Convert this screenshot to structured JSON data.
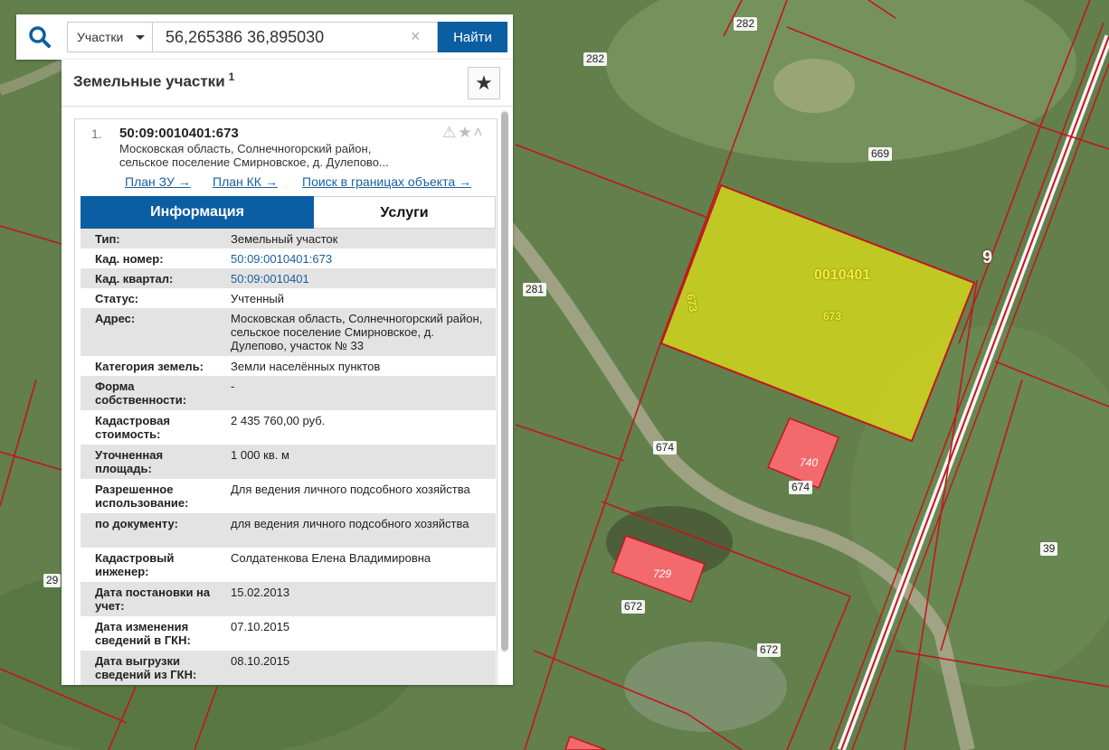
{
  "search": {
    "type_label": "Участки",
    "query": "56,265386 36,895030",
    "button_label": "Найти",
    "clear_glyph": "×"
  },
  "panel": {
    "title": "Земельные участки",
    "count": "1",
    "bookmark_glyph": "★"
  },
  "result": {
    "index": "1.",
    "cadastral_number": "50:09:0010401:673",
    "address_lines": [
      "Московская область, Солнечногорский район,",
      "сельское поселение Смирновское, д. Дулепово..."
    ],
    "icons_glyph": "⚠★˄",
    "links": [
      "План ЗУ →",
      "План КК →",
      "Поиск в границах объекта →"
    ]
  },
  "tabs": {
    "info": "Информация",
    "services": "Услуги"
  },
  "info_rows": [
    {
      "key": "Тип:",
      "value": "Земельный участок"
    },
    {
      "key": "Кад. номер:",
      "value": "50:09:0010401:673"
    },
    {
      "key": "Кад. квартал:",
      "value": "50:09:0010401"
    },
    {
      "key": "Статус:",
      "value": "Учтенный"
    },
    {
      "key": "Адрес:",
      "value": "Московская область, Солнечногорский район, сельское поселение Смирновское, д. Дулепово, участок № 33"
    },
    {
      "key": "Категория земель:",
      "value": "Земли населённых пунктов"
    },
    {
      "key": "Форма собственности:",
      "value": "-"
    },
    {
      "key": "Кадастровая стоимость:",
      "value": "2 435 760,00 руб."
    },
    {
      "key": "Уточненная площадь:",
      "value": "1 000 кв. м"
    },
    {
      "key": "Разрешенное использование:",
      "value": "Для ведения личного подсобного хозяйства"
    },
    {
      "key": "по документу:",
      "value": "для ведения личного подсобного хозяйства"
    },
    {
      "key": "Кадастровый инженер:",
      "value": "Солдатенкова Елена Владимировна"
    },
    {
      "key": "Дата постановки на учет:",
      "value": "15.02.2013"
    },
    {
      "key": "Дата изменения сведений в ГКН:",
      "value": "07.10.2015"
    },
    {
      "key": "Дата выгрузки сведений из ГКН:",
      "value": "08.10.2015"
    }
  ],
  "map": {
    "parcel_labels": [
      "282",
      "282",
      "669",
      "281",
      "674",
      "674",
      "672",
      "672",
      "39",
      "29"
    ],
    "quarter_label": "0010401",
    "selected_parcel_label": "673",
    "selected_parcel_side_label": "673",
    "building_labels": [
      "740",
      "729"
    ],
    "road_number": "9",
    "colors": {
      "selected_fill": "#d6d81c",
      "boundary": "#c3161c",
      "building_fill": "#f26a6e",
      "accent": "#0c5ea3"
    }
  }
}
